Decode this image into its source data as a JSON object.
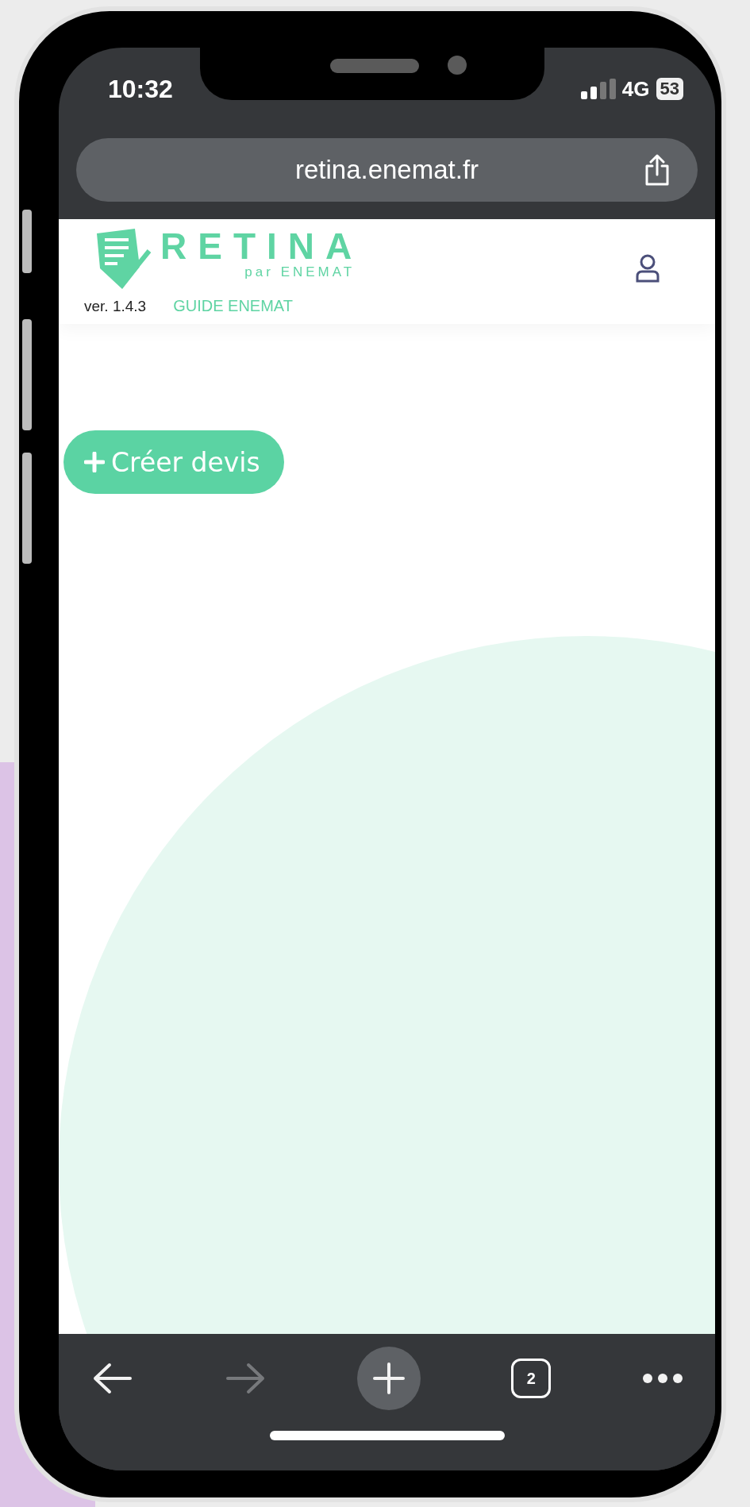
{
  "status_bar": {
    "time": "10:32",
    "network": "4G",
    "battery": "53"
  },
  "address_bar": {
    "url": "retina.enemat.fr"
  },
  "header": {
    "logo_title": "RETINA",
    "logo_subtitle": "par ENEMAT",
    "version": "ver. 1.4.3",
    "guide_link": "GUIDE ENEMAT"
  },
  "create_button": {
    "label": "Créer devis"
  },
  "toolbar": {
    "tab_count": "2",
    "forward_disabled": true
  }
}
